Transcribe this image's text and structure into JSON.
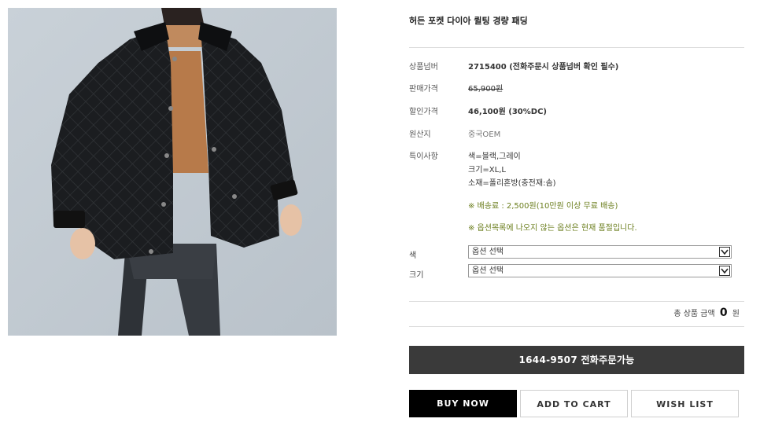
{
  "product": {
    "title": "허든 포켓 다이아 퀼팅 경량 패딩",
    "image_alt": "black quilted jacket model photo"
  },
  "details": {
    "code_label": "상품넘버",
    "code_value": "2715400 (전화주문시 상품넘버 확인 필수)",
    "price_label": "판매가격",
    "price_value": "65,900원",
    "sale_label": "할인가격",
    "sale_value": "46,100원 (30%DC)",
    "origin_label": "원산지",
    "origin_value": "중국OEM",
    "special_label": "특이사항",
    "special_lines": [
      "색=블랙,그레이",
      "크기=XL,L",
      "소재=폴리혼방(충전재:솜)"
    ],
    "notice_shipping": "※ 배송료 : 2,500원(10만원 이상 무료 배송)",
    "notice_option": "※ 옵션목록에 나오지 않는 옵션은 현재 품절입니다."
  },
  "options": {
    "color_label": "색",
    "color_selected": "옵션 선택",
    "size_label": "크기",
    "size_selected": "옵션 선택"
  },
  "total": {
    "label": "총 상품 금액",
    "amount": "0",
    "unit": "원"
  },
  "buttons": {
    "phone": "1644-9507 전화주문가능",
    "buy_now": "BUY NOW",
    "add_to_cart": "ADD TO CART",
    "wish_list": "WISH LIST"
  },
  "colors": {
    "phone_button_bg": "#3a3a3a",
    "buy_button_bg": "#000000",
    "notice_text": "#6b7e1d",
    "image_background": "#c3ccd4"
  }
}
